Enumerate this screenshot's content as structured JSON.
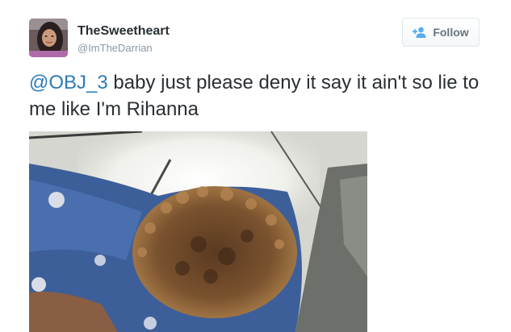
{
  "tweet": {
    "display_name": "TheSweetheart",
    "handle": "@ImTheDarrian",
    "follow_label": "Follow",
    "follow_icon": "add-user-icon",
    "text_mention": "@OBJ_3",
    "text_body": " baby just please deny it say it ain't so lie to me like I'm Rihanna"
  },
  "colors": {
    "link": "#2b7bb9",
    "text": "#292f33",
    "muted": "#8899a6",
    "follow_icon": "#55acee"
  }
}
